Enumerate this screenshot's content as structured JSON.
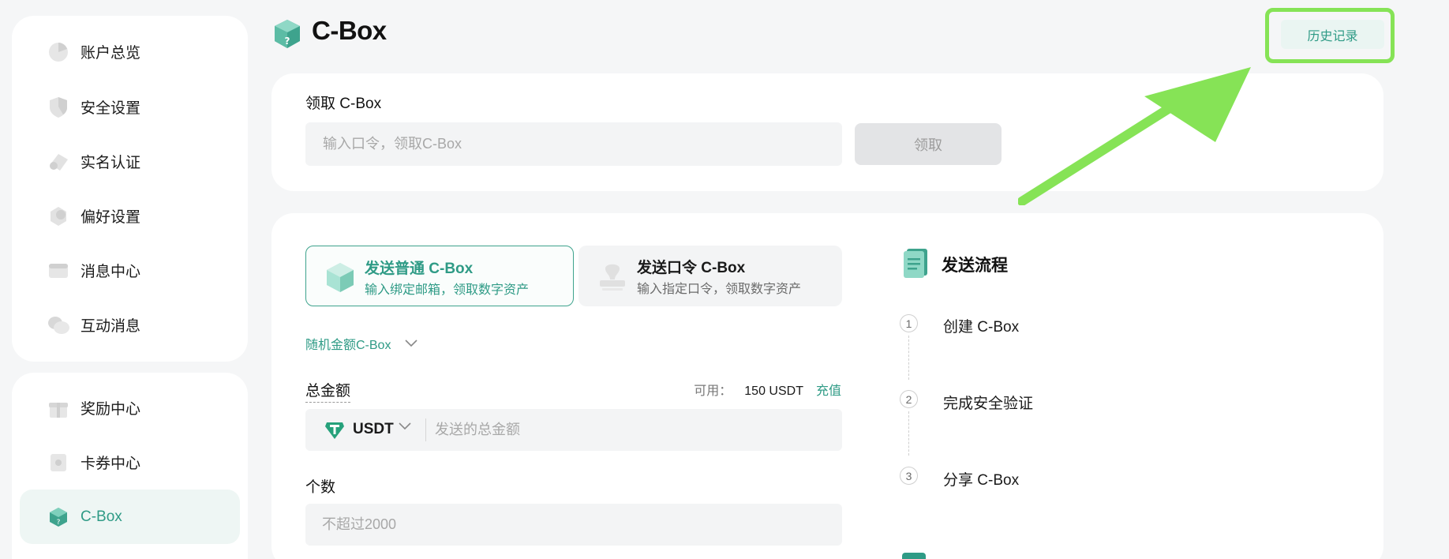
{
  "sidebar": {
    "group1": [
      {
        "label": "账户总览",
        "icon": "pie-chart-icon"
      },
      {
        "label": "安全设置",
        "icon": "shield-icon"
      },
      {
        "label": "实名认证",
        "icon": "id-badge-icon"
      },
      {
        "label": "偏好设置",
        "icon": "settings-icon"
      },
      {
        "label": "消息中心",
        "icon": "message-icon"
      },
      {
        "label": "互动消息",
        "icon": "chat-bubbles-icon"
      }
    ],
    "group2": [
      {
        "label": "奖励中心",
        "icon": "gift-icon"
      },
      {
        "label": "卡券中心",
        "icon": "coupon-icon"
      },
      {
        "label": "C-Box",
        "icon": "cbox-icon",
        "active": true
      }
    ]
  },
  "header": {
    "title": "C-Box",
    "history_label": "历史记录"
  },
  "claim": {
    "title": "领取 C-Box",
    "placeholder": "输入口令，领取C-Box",
    "button_label": "领取"
  },
  "send": {
    "types": [
      {
        "title": "发送普通 C-Box",
        "subtitle": "输入绑定邮箱，领取数字资产",
        "selected": true
      },
      {
        "title": "发送口令 C-Box",
        "subtitle": "输入指定口令，领取数字资产",
        "selected": false
      }
    ],
    "mode_label": "随机金额C-Box",
    "amount_label": "总金额",
    "available_key": "可用：",
    "available_value": "150 USDT",
    "recharge_label": "充值",
    "coin": "USDT",
    "amount_placeholder": "发送的总金额",
    "count_label": "个数",
    "count_placeholder": "不超过2000"
  },
  "flow": {
    "title": "发送流程",
    "steps": [
      {
        "num": "1",
        "label": "创建 C-Box"
      },
      {
        "num": "2",
        "label": "完成安全验证"
      },
      {
        "num": "3",
        "label": "分享 C-Box"
      }
    ]
  },
  "colors": {
    "accent": "#2f9b86",
    "highlight": "#86e356",
    "tether": "#26a17b"
  }
}
